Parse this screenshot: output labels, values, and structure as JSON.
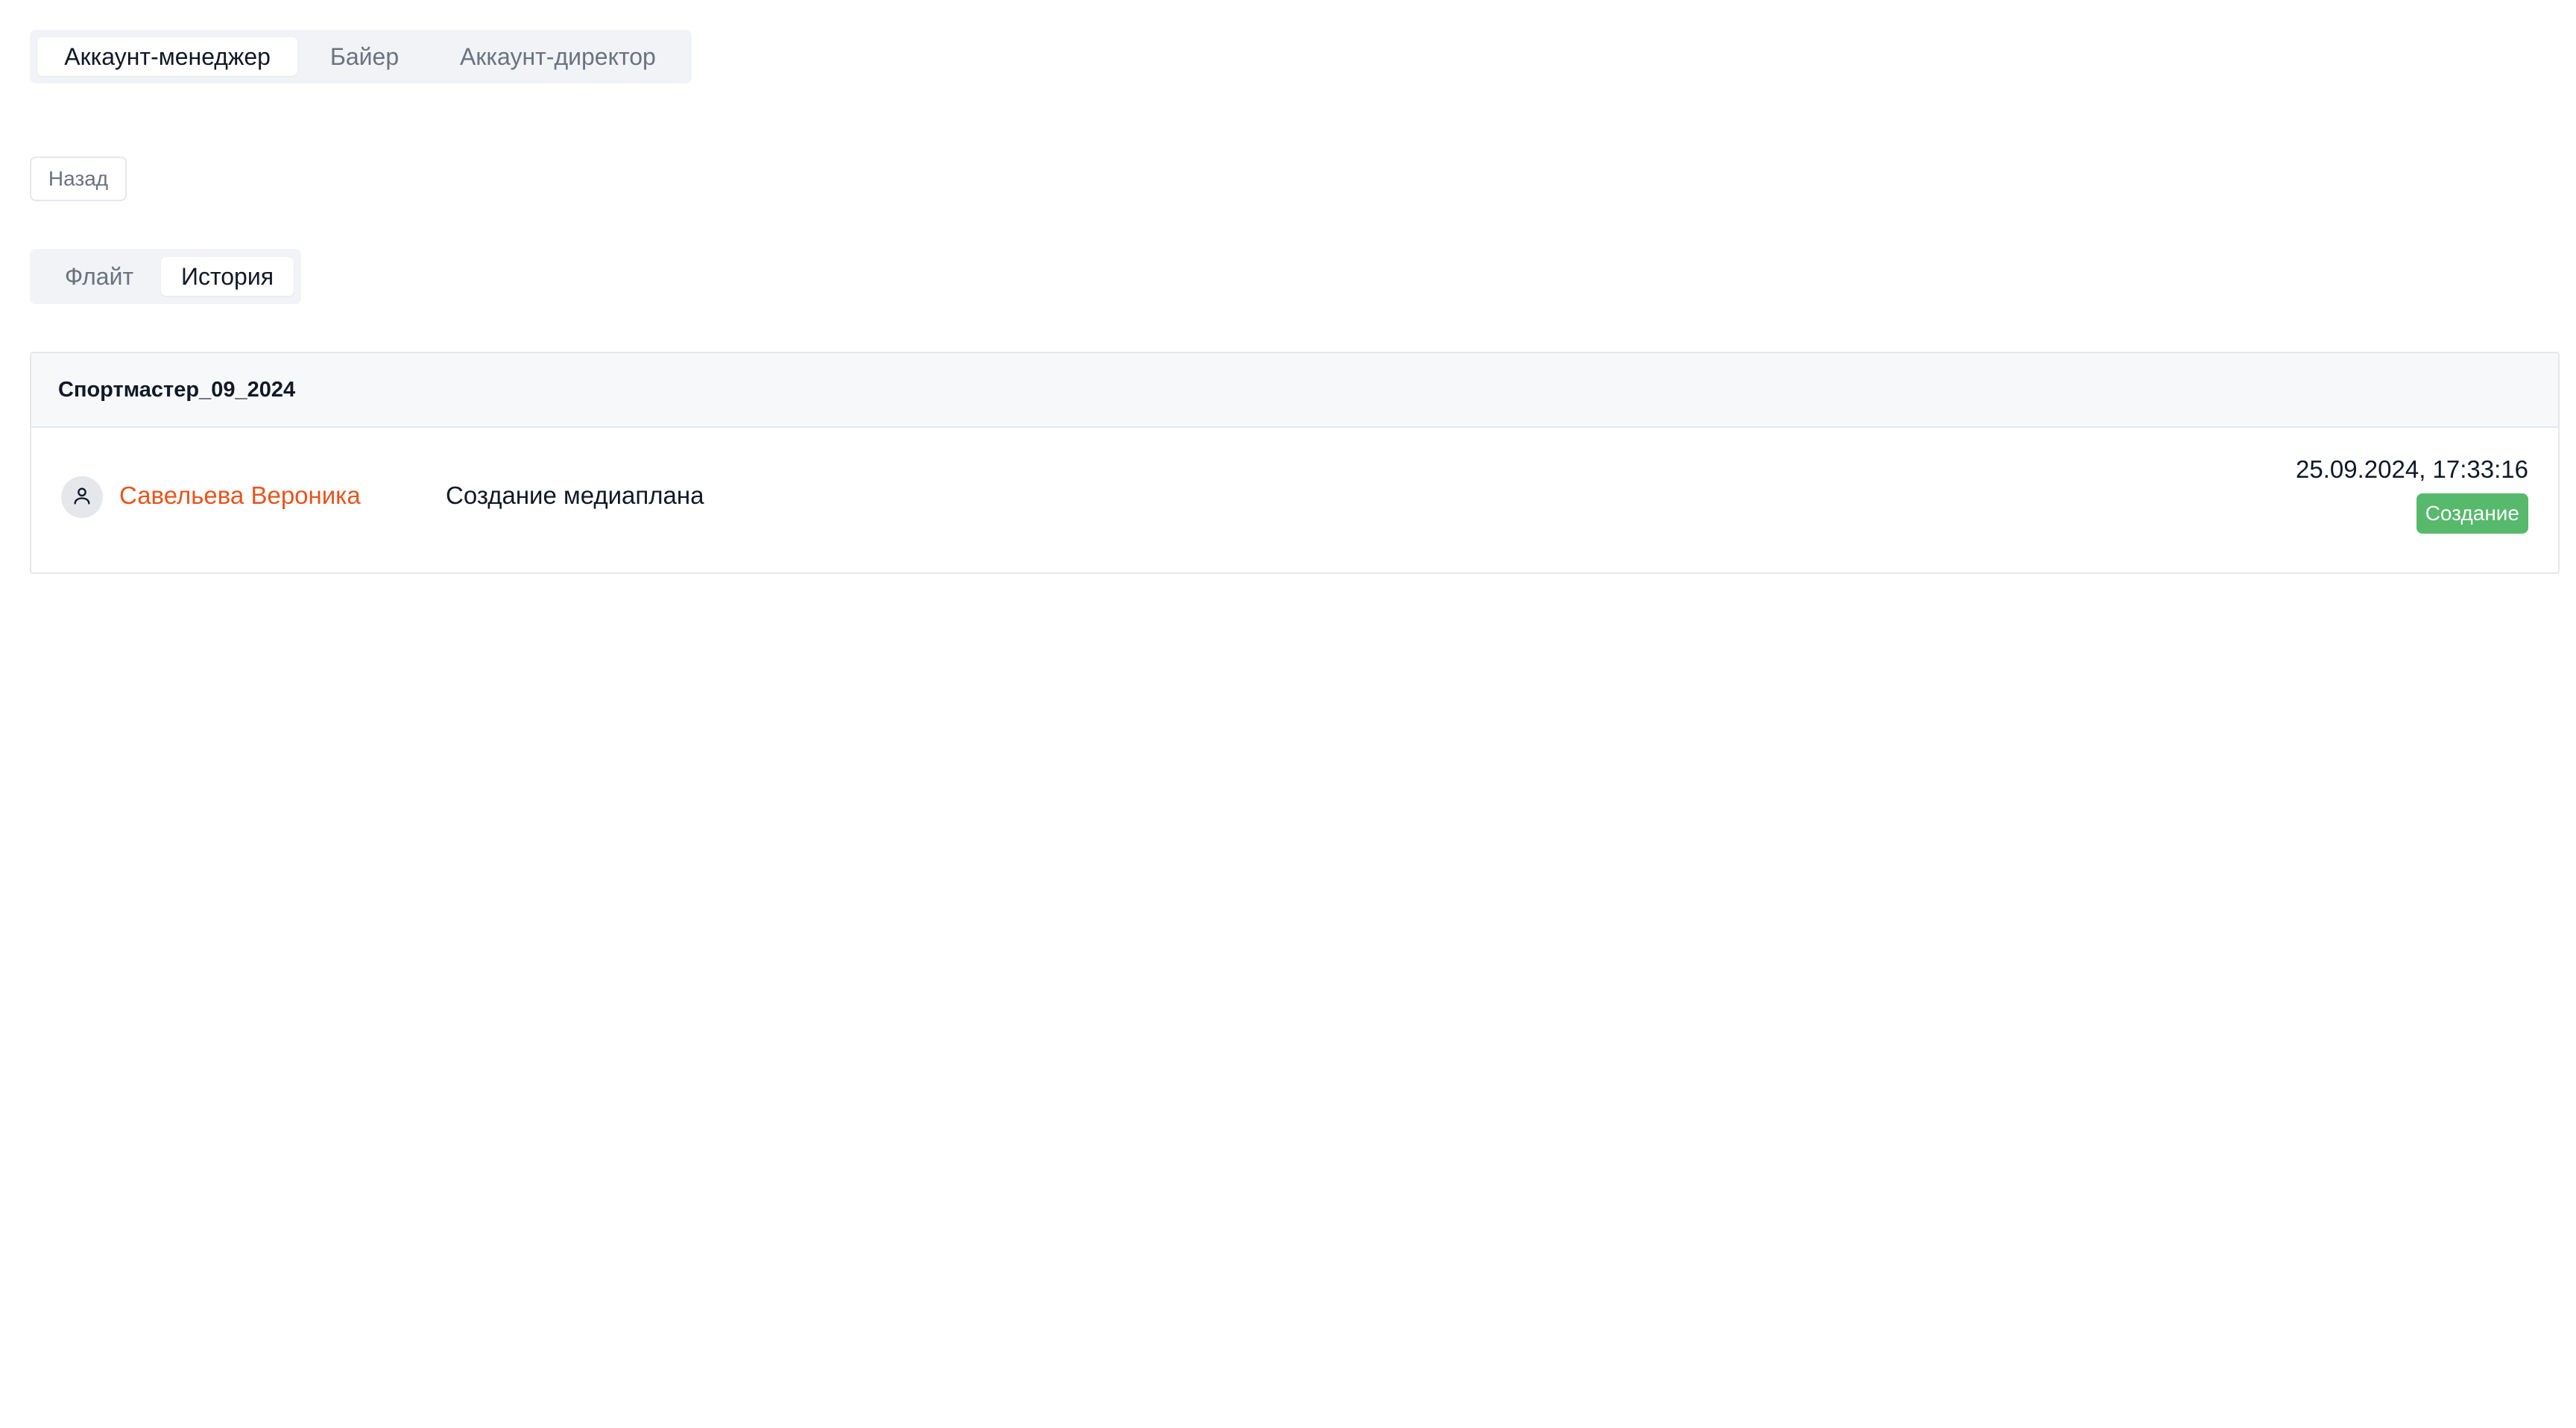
{
  "role_tabs": [
    {
      "label": "Аккаунт-менеджер",
      "active": true
    },
    {
      "label": "Байер",
      "active": false
    },
    {
      "label": "Аккаунт-директор",
      "active": false
    }
  ],
  "back_button": {
    "label": "Назад"
  },
  "view_tabs": [
    {
      "label": "Флайт",
      "active": false
    },
    {
      "label": "История",
      "active": true
    }
  ],
  "history": {
    "title": "Спортмастер_09_2024",
    "entries": [
      {
        "user_icon": "user-icon",
        "user_name": "Савельева Вероника",
        "action": "Создание медиаплана",
        "timestamp": "25.09.2024, 17:33:16",
        "badge": "Создание"
      }
    ]
  },
  "colors": {
    "accent_user": "#e8541e",
    "badge_create": "#56b96b"
  }
}
